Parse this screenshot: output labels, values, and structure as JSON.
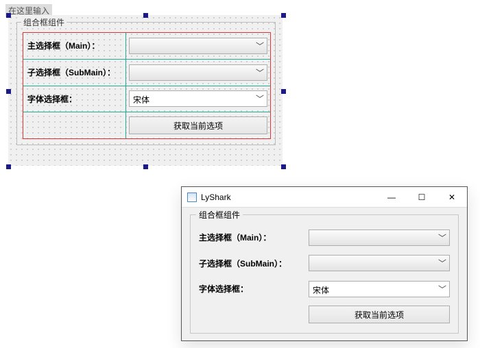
{
  "designer": {
    "placeholder": "在这里输入",
    "group_title": "组合框组件",
    "rows": {
      "main_label": "主选择框（Main）：",
      "sub_label": "子选择框（SubMain）：",
      "font_label": "字体选择框：",
      "font_value": "宋体",
      "button_label": "获取当前选项"
    }
  },
  "window": {
    "title": "LyShark",
    "controls": {
      "min": "—",
      "max": "☐",
      "close": "✕"
    },
    "group_title": "组合框组件",
    "rows": {
      "main_label": "主选择框（Main）：",
      "sub_label": "子选择框（SubMain）：",
      "font_label": "字体选择框：",
      "font_value": "宋体",
      "button_label": "获取当前选项"
    }
  }
}
